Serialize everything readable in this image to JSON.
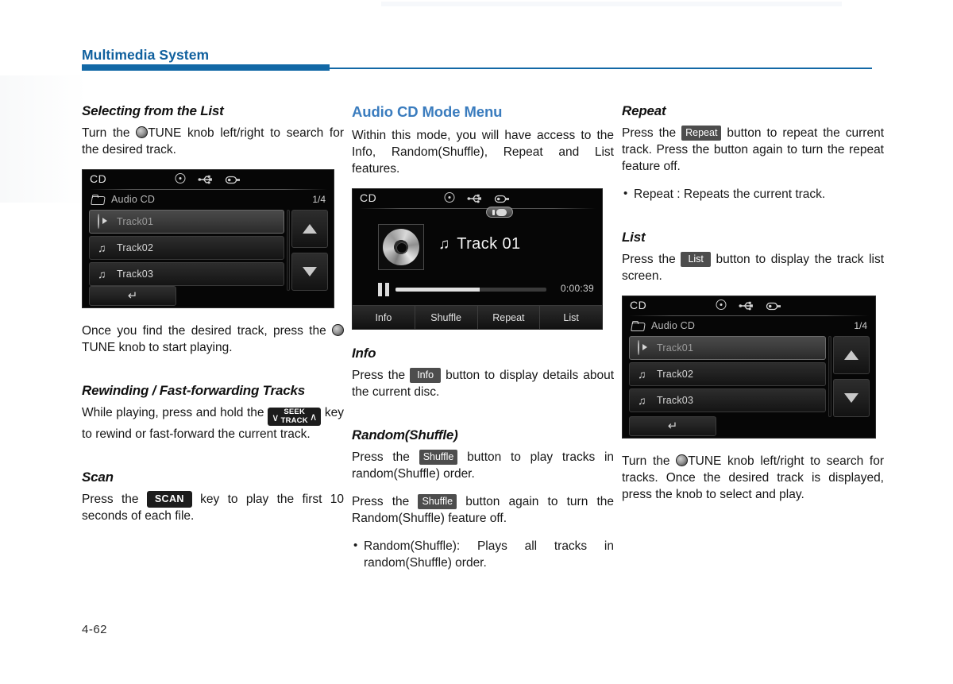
{
  "page": {
    "header_title": "Multimedia System",
    "page_number": "4-62"
  },
  "column1": {
    "s1_title": "Selecting from the List",
    "s1_p1_a": "Turn the ",
    "s1_p1_b": "TUNE knob left/right to search for the desired track.",
    "list_screen": {
      "cd_label": "CD",
      "breadcrumb": "Audio CD",
      "pager": "1/4",
      "tracks": [
        {
          "label": "Track01",
          "icon": "play-circle-icon",
          "selected": true
        },
        {
          "label": "Track02",
          "icon": "music-note-icon",
          "selected": false
        },
        {
          "label": "Track03",
          "icon": "music-note-icon",
          "selected": false
        }
      ],
      "scroll_up": "scroll-up-arrow",
      "scroll_down": "scroll-down-arrow",
      "back": "back-arrow-icon"
    },
    "s1_p2_a": "Once you find the desired track, press the ",
    "s1_p2_b": "TUNE knob to start playing.",
    "s2_title": "Rewinding / Fast-forwarding Tracks",
    "s2_p1_a": "While playing, press and hold the ",
    "s2_key_top": "SEEK",
    "s2_key_bottom": "TRACK",
    "s2_p1_b": " key to rewind or fast-forward the current track.",
    "s3_title": "Scan",
    "s3_p1_a": "Press the ",
    "s3_key": "SCAN",
    "s3_p1_b": " key to play the first 10 seconds of each file."
  },
  "column2": {
    "s1_title": "Audio CD Mode Menu",
    "s1_p1": "Within this mode, you will have access to the Info, Random(Shuffle), Repeat and List features.",
    "play_screen": {
      "cd_label": "CD",
      "badge": "repeat-one-badge",
      "track_title": "Track 01",
      "time": "0:00:39",
      "progress_percent": 56,
      "transport_state": "paused",
      "tabs": [
        {
          "label": "Info"
        },
        {
          "label": "Shuffle"
        },
        {
          "label": "Repeat"
        },
        {
          "label": "List"
        }
      ]
    },
    "s2_title": "Info",
    "s2_p1_a": "Press the ",
    "s2_key": "Info",
    "s2_p1_b": " button to display details about the current disc.",
    "s3_title": "Random(Shuffle)",
    "s3_p1_a": "Press the ",
    "s3_key": "Shuffle",
    "s3_p1_b": " button to play tracks in random(Shuffle) order.",
    "s3_p2_a": "Press the ",
    "s3_key2": "Shuffle",
    "s3_p2_b": " button again to turn the Random(Shuffle) feature off.",
    "s3_bullet1": "Random(Shuffle): Plays all tracks in random(Shuffle) order."
  },
  "column3": {
    "s1_title": "Repeat",
    "s1_p1_a": "Press the ",
    "s1_key": "Repeat",
    "s1_p1_b": " button to repeat the current track. Press the button again to turn the repeat feature off.",
    "s1_bullet1": "Repeat : Repeats the current track.",
    "s2_title": "List",
    "s2_p1_a": "Press the ",
    "s2_key": "List",
    "s2_p1_b": " button to display the track list screen.",
    "list_screen": {
      "cd_label": "CD",
      "breadcrumb": "Audio CD",
      "pager": "1/4",
      "tracks": [
        {
          "label": "Track01",
          "icon": "play-circle-icon",
          "selected": true
        },
        {
          "label": "Track02",
          "icon": "music-note-icon",
          "selected": false
        },
        {
          "label": "Track03",
          "icon": "music-note-icon",
          "selected": false
        }
      ],
      "scroll_up": "scroll-up-arrow",
      "scroll_down": "scroll-down-arrow",
      "back": "back-arrow-icon"
    },
    "s2_p2_a": "Turn the ",
    "s2_p2_b": "TUNE knob left/right to search for tracks. Once the desired track is displayed, press the knob to select and play."
  },
  "colors": {
    "accent_blue": "#1268a6",
    "title_blue": "#3a7cbe",
    "key_badge": "#4d4d4d",
    "key_badge_black": "#1c1c1c",
    "screen_bg": "#060606"
  }
}
